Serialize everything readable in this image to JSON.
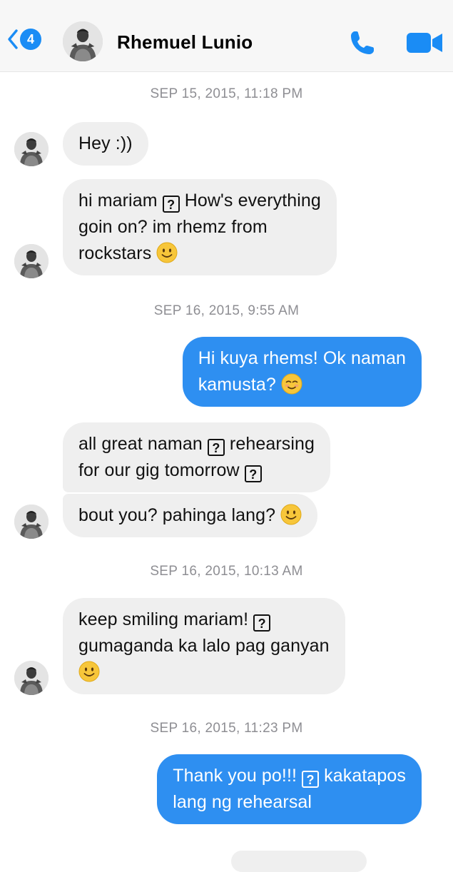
{
  "header": {
    "back_count": "4",
    "contact_name": "Rhemuel Lunio",
    "accent_color": "#1a8cf5"
  },
  "timestamps": {
    "t1": "SEP 15, 2015, 11:18 PM",
    "t2": "SEP 16, 2015, 9:55 AM",
    "t3": "SEP 16, 2015, 10:13 AM",
    "t4": "SEP 16, 2015, 11:23 PM"
  },
  "messages": {
    "m1": {
      "sender": "them",
      "l1": "Hey :))"
    },
    "m2": {
      "sender": "them",
      "l1a": "hi mariam",
      "l1b": "How's everything",
      "l2": "goin on? im rhemz from",
      "l3": "rockstars",
      "icons": [
        "unknown-glyph",
        "smile-emoji"
      ]
    },
    "m3": {
      "sender": "me",
      "l1": "Hi kuya rhems! Ok naman",
      "l2": "kamusta?",
      "icons": [
        "blush-emoji"
      ]
    },
    "m4": {
      "sender": "them",
      "l1a": "all great naman",
      "l1b": "rehearsing",
      "l2": "for our gig tomorrow",
      "icons": [
        "unknown-glyph",
        "unknown-glyph"
      ]
    },
    "m5": {
      "sender": "them",
      "l1": "bout you? pahinga lang?",
      "icons": [
        "smile-emoji"
      ]
    },
    "m6": {
      "sender": "them",
      "l1": "keep smiling mariam!",
      "l2": "gumaganda ka lalo pag ganyan",
      "icons": [
        "unknown-glyph",
        "smile-emoji"
      ]
    },
    "m7": {
      "sender": "me",
      "l1a": "Thank you po!!!",
      "l1b": "kakatapos",
      "l2": "lang ng rehearsal",
      "icons": [
        "unknown-glyph"
      ]
    }
  },
  "colors": {
    "incoming_bubble": "#efefef",
    "outgoing_bubble": "#2e8ff1",
    "timestamp_text": "#8e8e93"
  }
}
